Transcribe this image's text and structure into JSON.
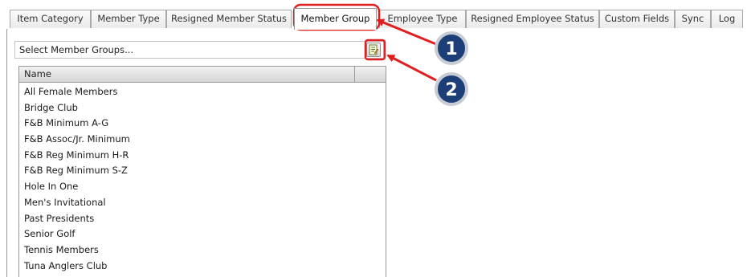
{
  "tabs": [
    {
      "label": "Item Category",
      "active": false
    },
    {
      "label": "Member Type",
      "active": false
    },
    {
      "label": "Resigned Member Status",
      "active": false
    },
    {
      "label": "Member Group",
      "active": true
    },
    {
      "label": "Employee Type",
      "active": false
    },
    {
      "label": "Resigned Employee Status",
      "active": false
    },
    {
      "label": "Custom Fields",
      "active": false
    },
    {
      "label": "Sync",
      "active": false
    },
    {
      "label": "Log",
      "active": false
    }
  ],
  "selector": {
    "value": "Select Member Groups...",
    "button_icon": "edit-list-icon"
  },
  "grid": {
    "column_header": "Name",
    "rows": [
      "All Female Members",
      "Bridge Club",
      "F&B  Minimum A-G",
      "F&B Assoc/Jr. Minimum",
      "F&B Reg Minimum H-R",
      "F&B Reg Minimum S-Z",
      "Hole In One",
      "Men's Invitational",
      "Past Presidents",
      "Senior Golf",
      "Tennis Members",
      "Tuna Anglers Club"
    ]
  },
  "annotations": {
    "accent_color": "#e02020",
    "badge_color": "#1c3f78",
    "callouts": [
      {
        "number": "1",
        "target": "Member Group tab"
      },
      {
        "number": "2",
        "target": "select groups button"
      }
    ]
  }
}
